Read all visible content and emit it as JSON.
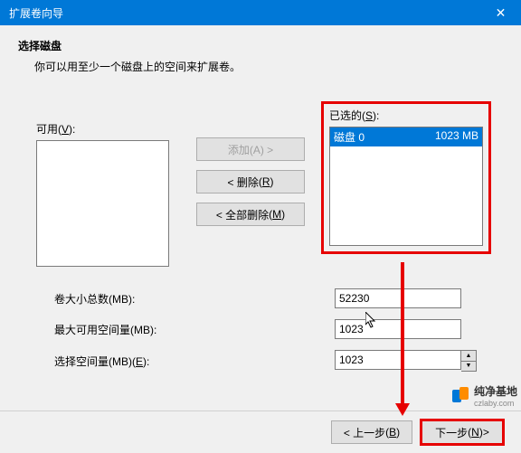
{
  "window": {
    "title": "扩展卷向导"
  },
  "heading": "选择磁盘",
  "subheading": "你可以用至少一个磁盘上的空间来扩展卷。",
  "labels": {
    "available": "可用",
    "available_accel": "V",
    "selected": "已选的",
    "selected_accel": "S"
  },
  "buttons": {
    "add": "添加(A) >",
    "remove": "< 删除",
    "remove_accel": "R",
    "remove_all": "< 全部删除",
    "remove_all_accel": "M",
    "back": "< 上一步",
    "back_accel": "B",
    "next": "下一步",
    "next_accel": "N",
    "next_suffix": " >"
  },
  "selected_items": [
    {
      "name": "磁盘 0",
      "size": "1023 MB"
    }
  ],
  "fields": {
    "total_label": "卷大小总数(MB):",
    "total_value": "52230",
    "max_label": "最大可用空间量(MB):",
    "max_value": "1023",
    "select_label": "选择空间量(MB)",
    "select_accel": "E",
    "select_value": "1023"
  },
  "watermark": {
    "brand": "纯净基地",
    "url": "czlaby.com"
  }
}
